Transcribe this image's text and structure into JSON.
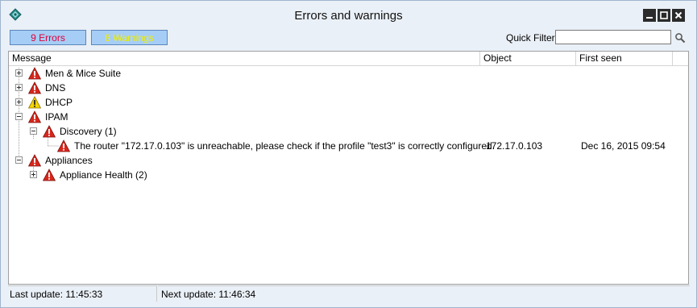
{
  "window": {
    "title": "Errors and warnings",
    "icon": "diamond-app-icon"
  },
  "toolbar": {
    "errors_label": "9 Errors",
    "warnings_label": "8 Warnings",
    "quick_filter_label": "Quick Filter:",
    "quick_filter_value": ""
  },
  "columns": {
    "message": "Message",
    "object": "Object",
    "first_seen": "First seen"
  },
  "tree": {
    "men_mice": {
      "label": "Men & Mice Suite",
      "icon": "error-icon",
      "expander": "plus"
    },
    "dns": {
      "label": "DNS",
      "icon": "error-icon",
      "expander": "plus"
    },
    "dhcp": {
      "label": "DHCP",
      "icon": "warning-icon",
      "expander": "plus"
    },
    "ipam": {
      "label": "IPAM",
      "icon": "error-icon",
      "expander": "minus"
    },
    "discovery": {
      "label": "Discovery (1)",
      "icon": "error-icon",
      "expander": "minus"
    },
    "router_msg": {
      "label": "The router \"172.17.0.103\" is unreachable, please check if the profile \"test3\" is correctly configured.",
      "object": "172.17.0.103",
      "first_seen": "Dec 16, 2015 09:54",
      "icon": "error-icon"
    },
    "appliances": {
      "label": "Appliances",
      "icon": "error-icon",
      "expander": "minus"
    },
    "appliance_health": {
      "label": "Appliance Health (2)",
      "icon": "error-icon",
      "expander": "plus"
    }
  },
  "status": {
    "last_update": "Last update: 11:45:33",
    "next_update": "Next update: 11:46:34"
  },
  "colors": {
    "errors_text": "#e0003c",
    "warnings_text": "#f0f000",
    "filter_button_bg": "#a6cdf5",
    "error_icon": "#d9261c",
    "warning_icon": "#f5d400",
    "chrome_bg": "#eaf0f7"
  }
}
